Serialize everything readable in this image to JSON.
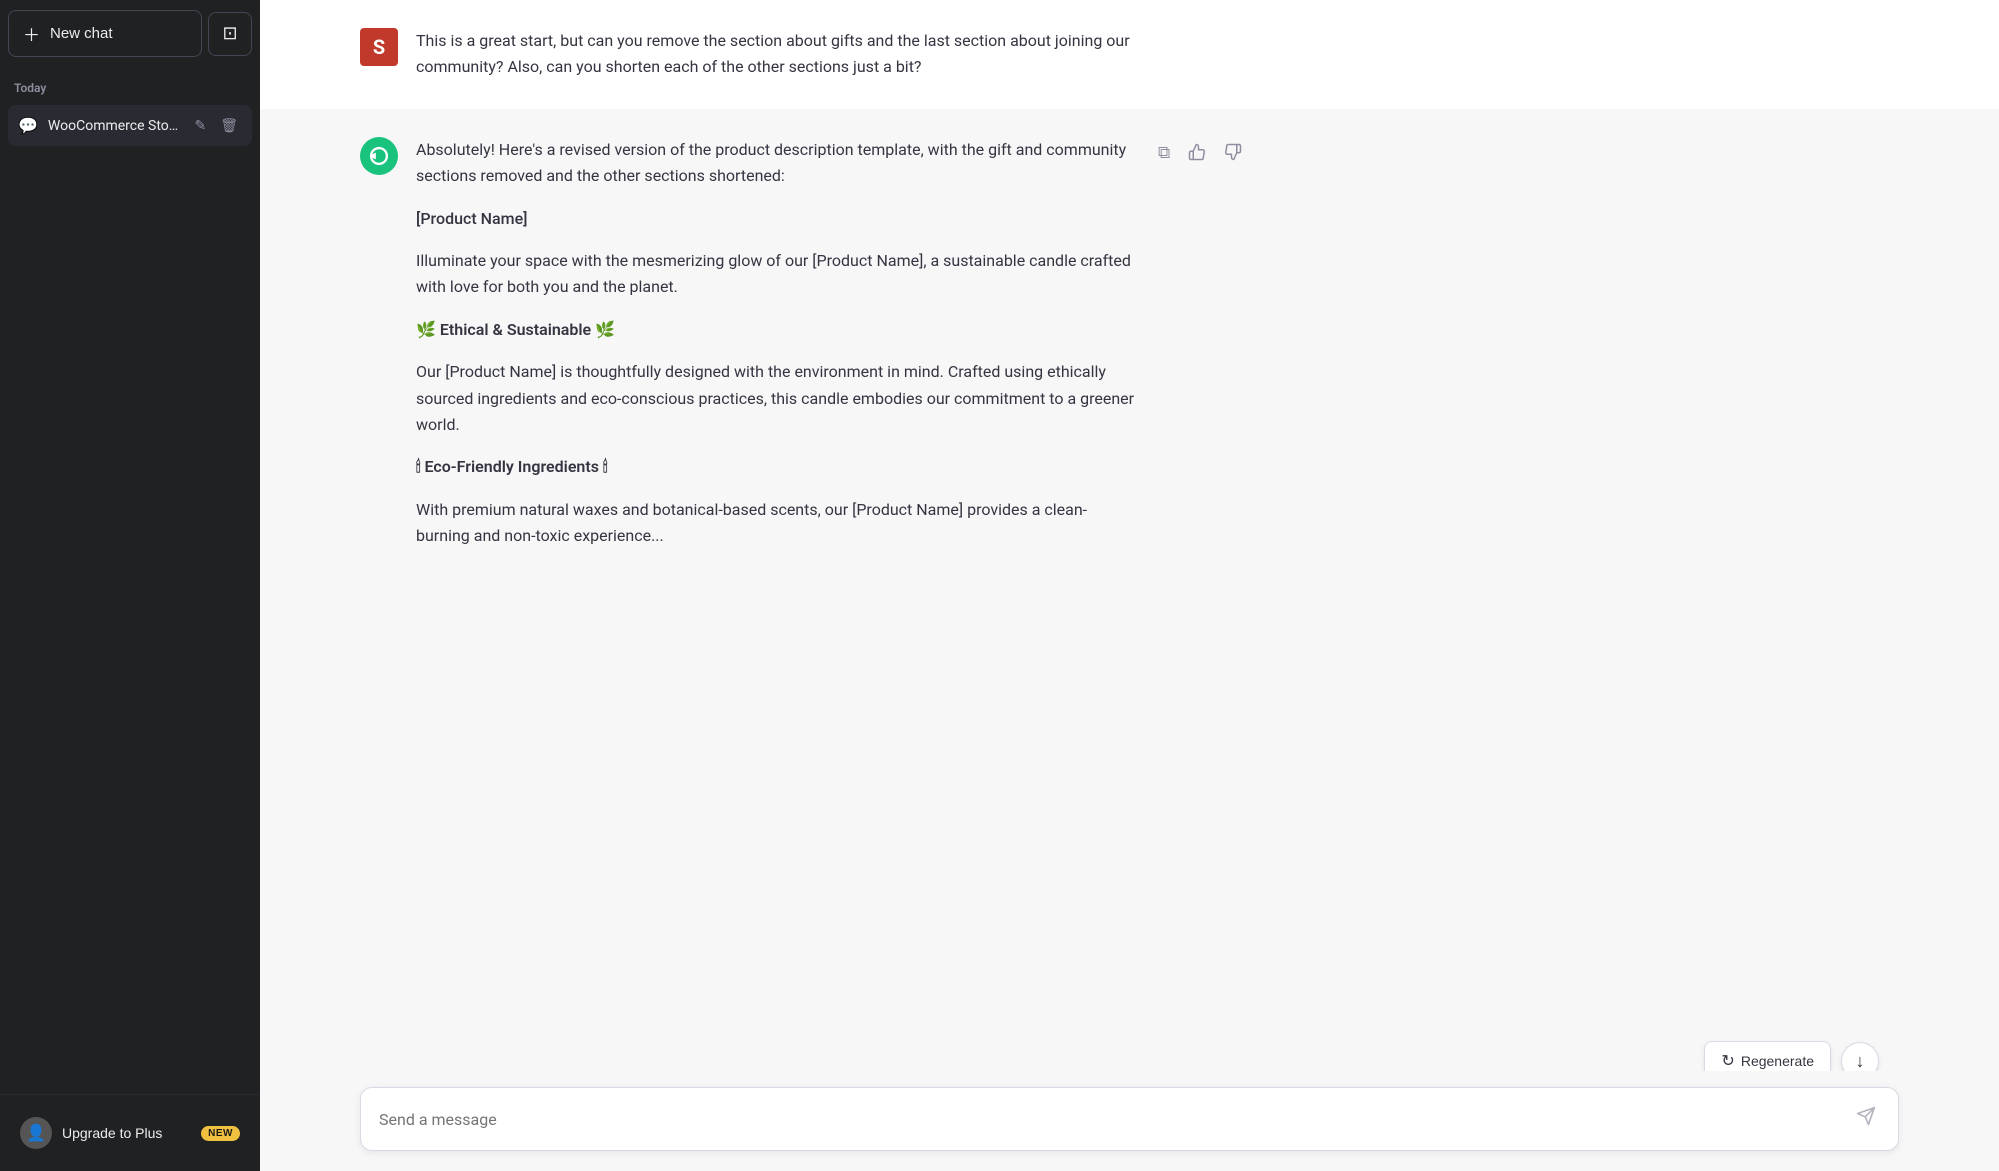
{
  "sidebar": {
    "new_chat_label": "New chat",
    "toggle_icon": "⊞",
    "section_label": "Today",
    "chats": [
      {
        "id": "woocommerce",
        "label": "WooCommerce Store"
      }
    ],
    "footer": {
      "upgrade_label": "Upgrade to Plus",
      "badge": "NEW"
    }
  },
  "chat": {
    "messages": [
      {
        "role": "user",
        "avatar_letter": "S",
        "text": "This is a great start, but can you remove the section about gifts and the last section about joining our community? Also, can you shorten each of the other sections just a bit?"
      },
      {
        "role": "assistant",
        "intro": "Absolutely! Here's a revised version of the product description template, with the gift and community sections removed and the other sections shortened:",
        "product_name": "[Product Name]",
        "body_intro": "Illuminate your space with the mesmerizing glow of our [Product Name], a sustainable candle crafted with love for both you and the planet.",
        "section1_header": "🌿 Ethical & Sustainable 🌿",
        "section1_body": "Our [Product Name] is thoughtfully designed with the environment in mind. Crafted using ethically sourced ingredients and eco-conscious practices, this candle embodies our commitment to a greener world.",
        "section2_header": "🕯 Eco-Friendly Ingredients 🕯",
        "section2_body": "With premium natural waxes and botanical-based scents, our [Product Name] provides a clean-burning and non-toxic experience..."
      }
    ],
    "actions": {
      "copy_icon": "⧉",
      "thumbup_icon": "👍",
      "thumbdown_icon": "👎"
    },
    "input_placeholder": "Send a message",
    "send_icon": "➤",
    "regenerate_label": "Regenerate",
    "regenerate_icon": "↻",
    "scroll_down_icon": "↓"
  }
}
